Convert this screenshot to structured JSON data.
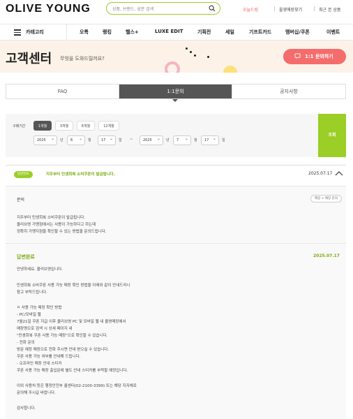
{
  "header": {
    "logo": "OLIVE YOUNG",
    "search_placeholder": "상품, 브랜드, 성분 검색",
    "util_links": [
      "오늘드림",
      "올영매장찾기",
      "최근 본 상품"
    ]
  },
  "nav": {
    "category_label": "카테고리",
    "items": [
      "오특",
      "랭킹",
      "헬스+",
      "LUXE EDIT",
      "기획전",
      "세일",
      "기프트카드",
      "멤버십/쿠폰",
      "이벤트"
    ]
  },
  "banner": {
    "title": "고객센터",
    "subtitle": "무엇을 도와드릴까요?",
    "ask_button": "1:1 문의하기"
  },
  "tabs": [
    "FAQ",
    "1:1문의",
    "공지사항"
  ],
  "filter": {
    "label": "구매기간",
    "periods": [
      "1개월",
      "3개월",
      "6개월",
      "12개월"
    ],
    "active_period": "1개월",
    "from": {
      "year": "2025",
      "month": "6",
      "day": "17"
    },
    "to": {
      "year": "2025",
      "month": "7",
      "day": "17"
    },
    "unit_year": "년",
    "unit_month": "월",
    "unit_day": "일",
    "range_sep": "~",
    "search_button": "조회"
  },
  "inquiry": {
    "status_badge": "답변완료",
    "title": "지주부터 민생회복 소비쿠폰이 발급됩니다.",
    "date": "2025.07.17",
    "question_label": "문의",
    "category_tag": "매장 > 매장 문의",
    "question_lines": [
      "지주부터 민생회복 소비쿠폰이 발급됩니다.",
      "올리브영 가맹점에서는 사용이 가능하다고 하는데",
      "정확히 가맹지점을 확인할 수 있는 방법을 문의드립니다."
    ],
    "answer_label": "답변완료",
    "answer_date": "2025.07.17",
    "answer_lines": [
      "안녕하세요. 올리브영입니다.",
      "",
      "민생회복 소비쿠폰 사용 가능 매장 확인 방법을 아래와 같이 안내드리니",
      "참고 부탁드립니다.",
      "",
      "ㅁ 사용 가능 매장 확인 방법",
      "- PC/모바일 웹",
      "7월21일 쿠폰 지급 이후 올리브영 PC 및 모바일 웹 내 올영매장에서",
      "매장명으로 검색 시 상세 페이지 내",
      "\"민생회복 쿠폰 사용 가능 매장\"으로 확인할 수 있습니다.",
      "- 전화 문의",
      "방문 예정 매장으로 전화 주시면 안내 받으실 수 있습니다.",
      "쿠폰 사용 가능 여부를 안내해 드립니다.",
      "- 오프라인 매장 안내 스티커",
      "쿠폰 사용 가능 매장 출입문에 별도 안내 스티커를 부착할 예정입니다.",
      "",
      "이외 사용처 등은 행정안전부 콜센터(02-2100-3399) 또는 해당 지자체로",
      "문의해 주시길 바랍니다.",
      "",
      "감사합니다."
    ]
  },
  "colors": {
    "brand_green": "#9bce26",
    "accent_coral": "#f56c6c",
    "banner_bg": "#fcf2e8"
  }
}
